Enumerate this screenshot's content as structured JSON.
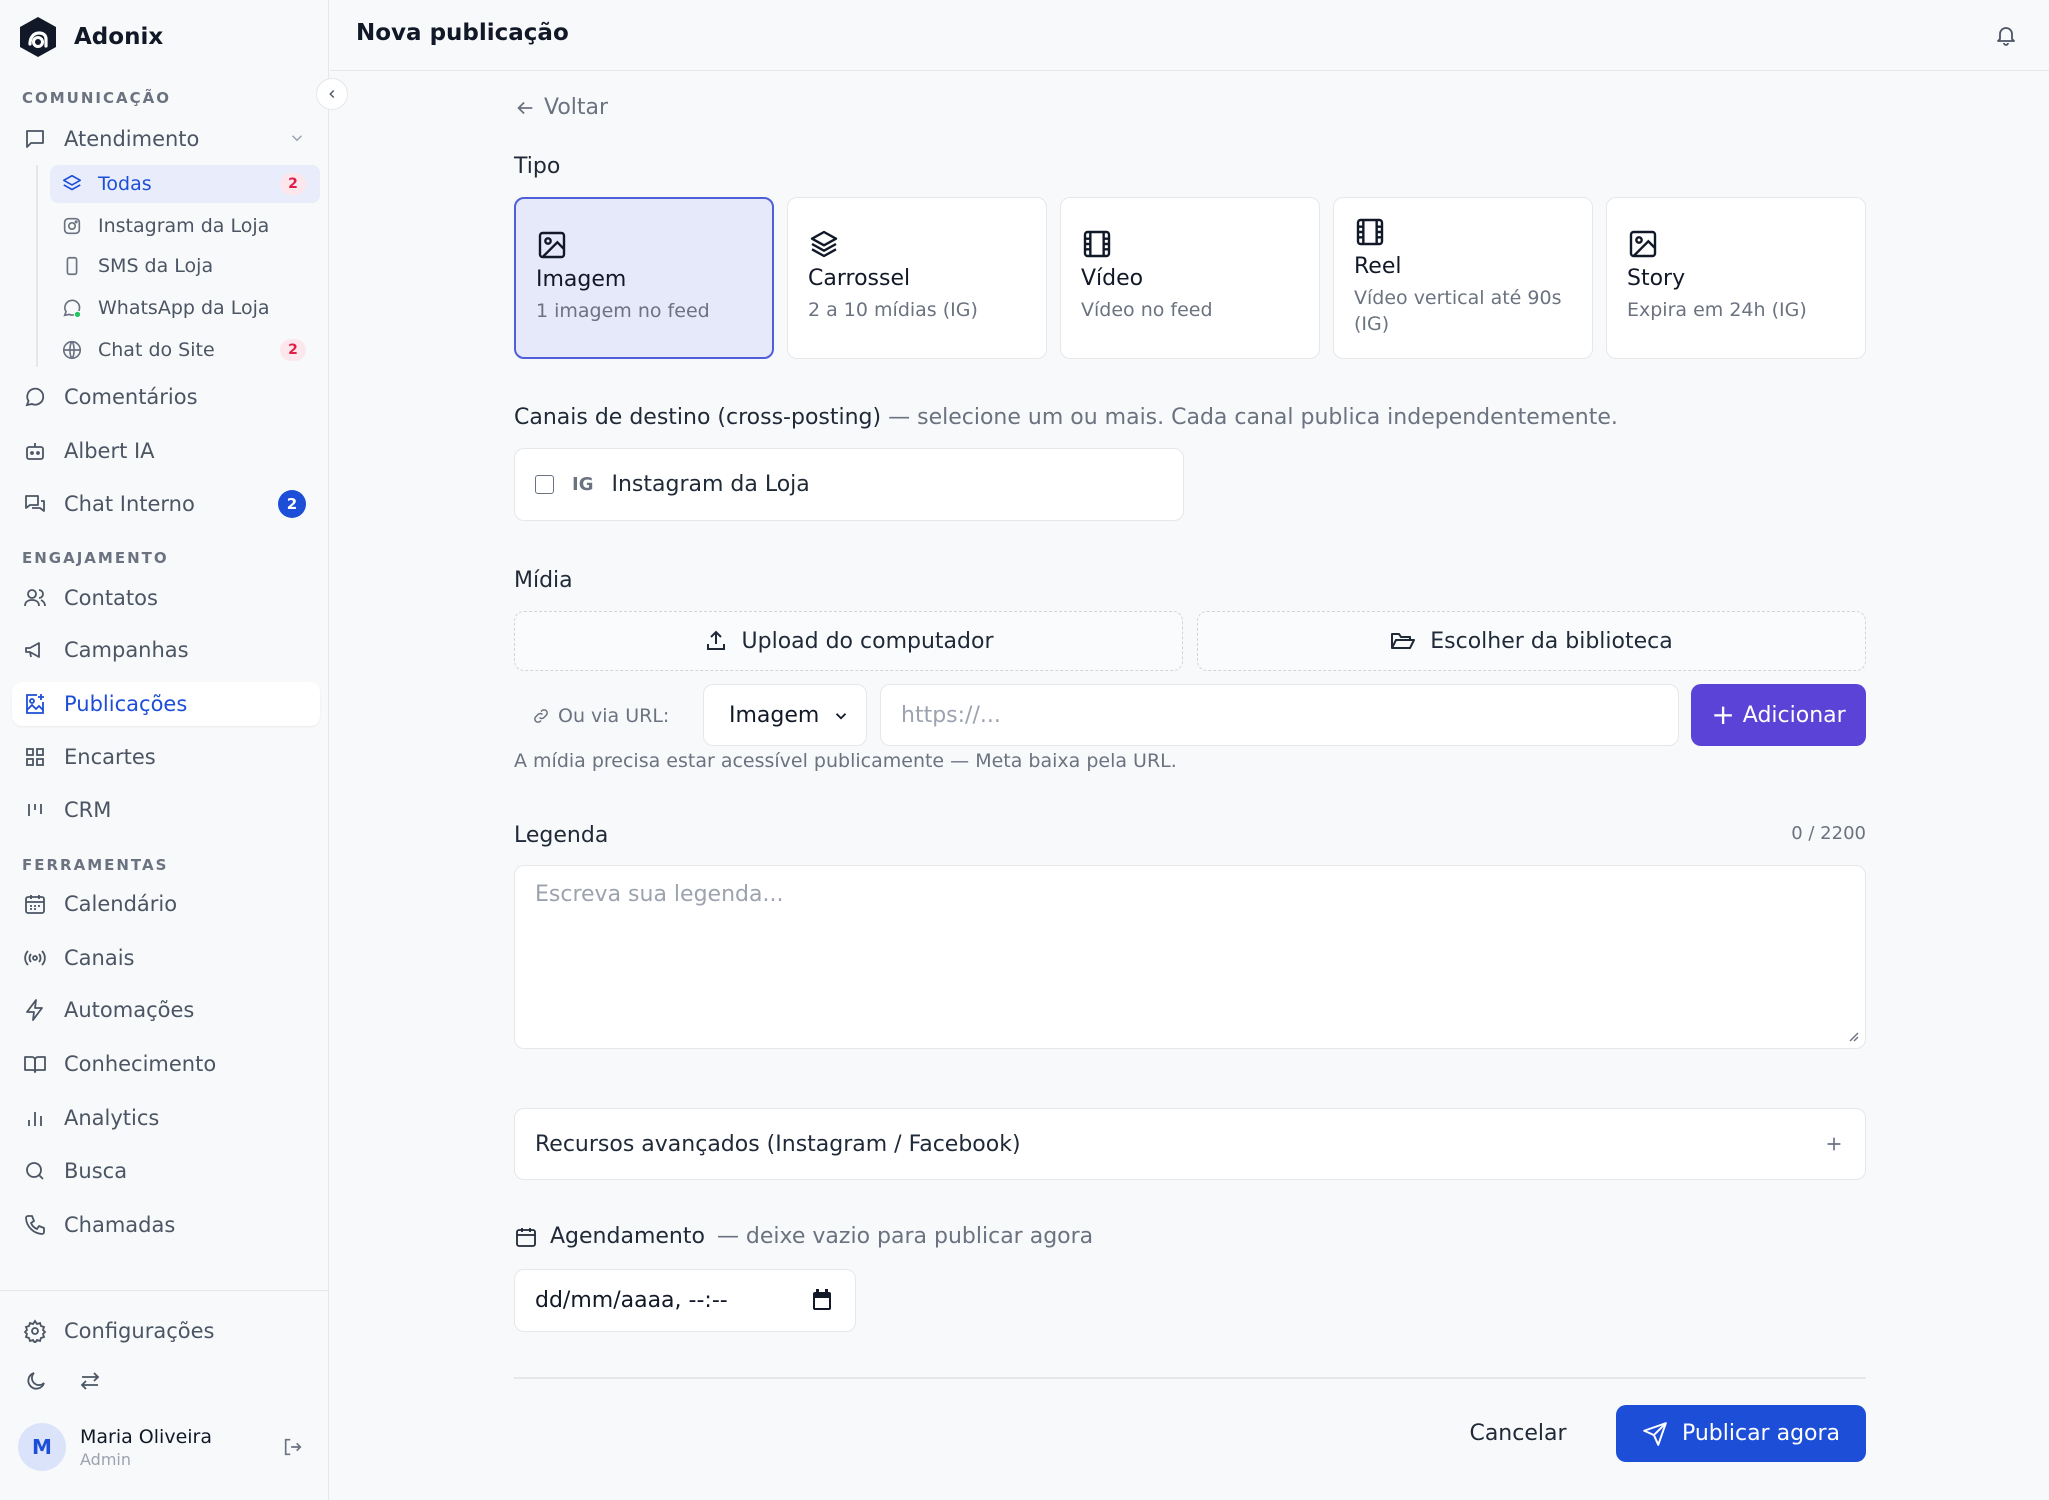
{
  "app": {
    "brand": "Adonix"
  },
  "header": {
    "title": "Nova publicação"
  },
  "sidebar": {
    "sections": {
      "comunicacao": "COMUNICAÇÃO",
      "engajamento": "ENGAJAMENTO",
      "ferramentas": "FERRAMENTAS"
    },
    "atendimento": {
      "label": "Atendimento",
      "subitems": [
        {
          "label": "Todas",
          "count": "2",
          "icon": "layers-icon"
        },
        {
          "label": "Instagram da Loja",
          "icon": "instagram-icon"
        },
        {
          "label": "SMS da Loja",
          "icon": "phone-icon"
        },
        {
          "label": "WhatsApp da Loja",
          "icon": "whatsapp-icon"
        },
        {
          "label": "Chat do Site",
          "count": "2",
          "icon": "globe-icon"
        }
      ]
    },
    "items": {
      "comentarios": "Comentários",
      "albert": "Albert IA",
      "chat_interno": "Chat Interno",
      "chat_interno_count": "2",
      "contatos": "Contatos",
      "campanhas": "Campanhas",
      "publicacoes": "Publicações",
      "encartes": "Encartes",
      "crm": "CRM",
      "calendario": "Calendário",
      "canais": "Canais",
      "automacoes": "Automações",
      "conhecimento": "Conhecimento",
      "analytics": "Analytics",
      "busca": "Busca",
      "chamadas": "Chamadas",
      "configuracoes": "Configurações"
    },
    "user": {
      "initial": "M",
      "name": "Maria Oliveira",
      "role": "Admin"
    }
  },
  "main": {
    "back": "Voltar",
    "tipo_label": "Tipo",
    "types": [
      {
        "title": "Imagem",
        "desc": "1 imagem no feed",
        "icon": "image-icon",
        "selected": true
      },
      {
        "title": "Carrossel",
        "desc": "2 a 10 mídias (IG)",
        "icon": "layers-icon"
      },
      {
        "title": "Vídeo",
        "desc": "Vídeo no feed",
        "icon": "film-icon"
      },
      {
        "title": "Reel",
        "desc": "Vídeo vertical até 90s (IG)",
        "icon": "film-icon"
      },
      {
        "title": "Story",
        "desc": "Expira em 24h (IG)",
        "icon": "image-icon"
      }
    ],
    "canais_label": "Canais de destino (cross-posting)",
    "canais_hint": "— selecione um ou mais. Cada canal publica independentemente.",
    "channel": {
      "tag": "IG",
      "name": "Instagram da Loja",
      "checked": false
    },
    "midia_label": "Mídia",
    "upload_label": "Upload do computador",
    "library_label": "Escolher da biblioteca",
    "url_label": "Ou via URL:",
    "media_type_selected": "Imagem",
    "url_placeholder": "https://...",
    "add_label": "Adicionar",
    "help_text": "A mídia precisa estar acessível publicamente — Meta baixa pela URL.",
    "legenda_label": "Legenda",
    "char_count": "0 / 2200",
    "caption_placeholder": "Escreva sua legenda...",
    "advanced_label": "Recursos avançados (Instagram / Facebook)",
    "agendamento_label": "Agendamento",
    "agendamento_hint": "— deixe vazio para publicar agora",
    "date_placeholder": "dd/mm/aaaa, --:--",
    "cancel_label": "Cancelar",
    "publish_label": "Publicar agora"
  },
  "colors": {
    "accent": "#1d4ed8",
    "add_button": "#5a43d6",
    "selected_card": "#e6e9fa",
    "badge_red": "#e11d48"
  }
}
